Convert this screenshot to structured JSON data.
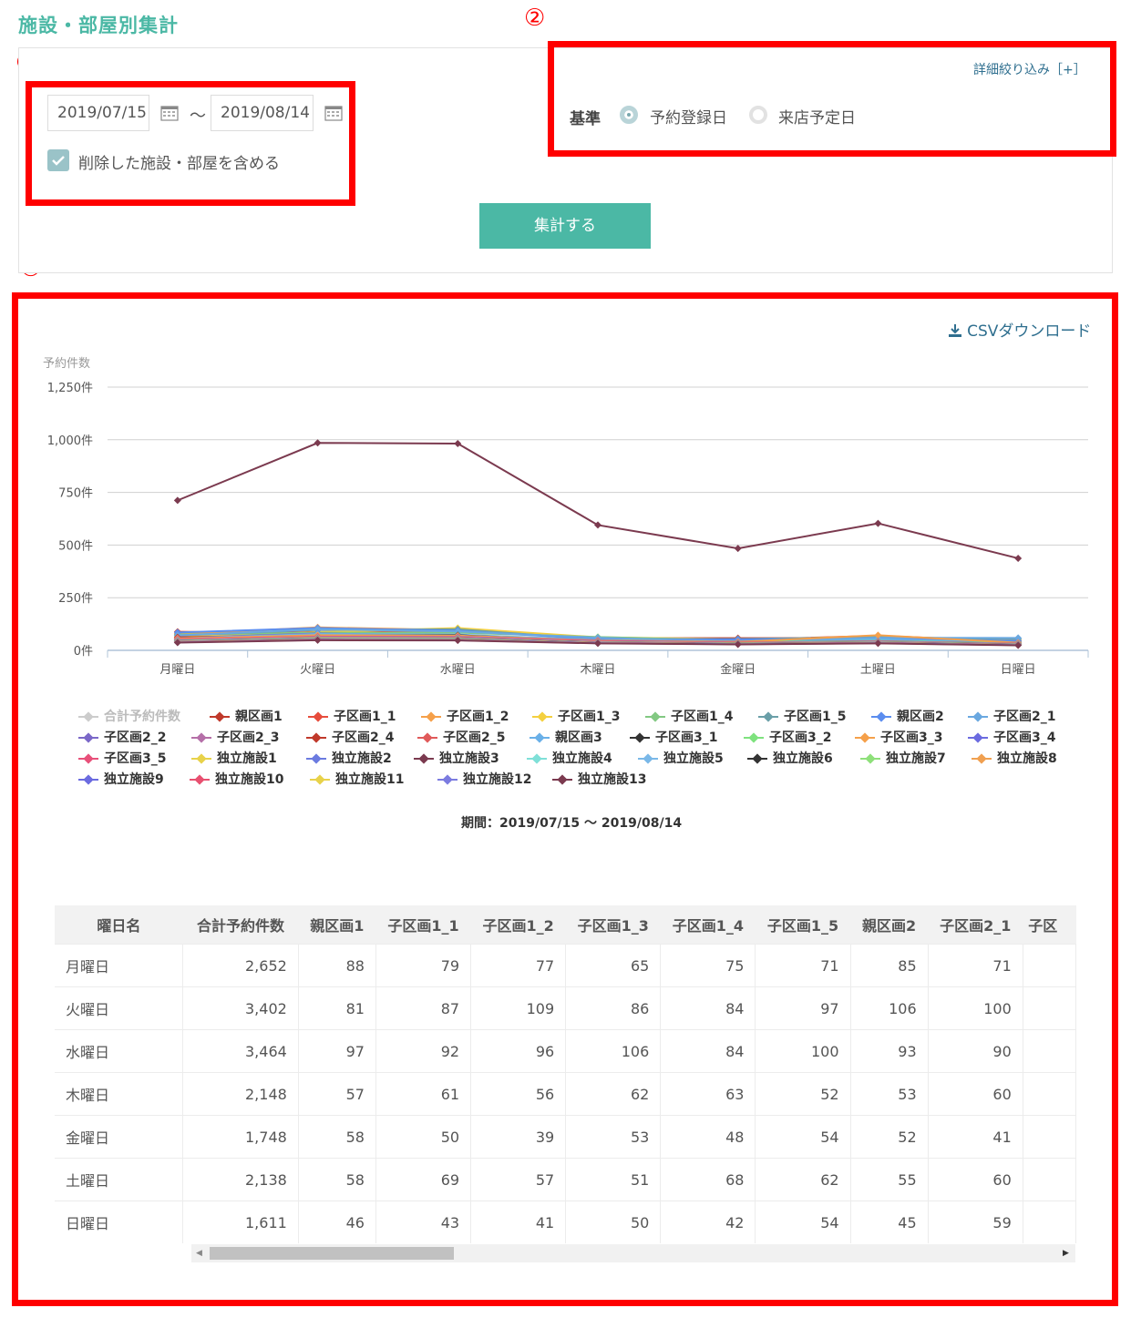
{
  "page": {
    "title": "施設・部屋別集計"
  },
  "markers": [
    "①",
    "②",
    "③"
  ],
  "filters": {
    "date_from": "2019/07/15",
    "tilde": "〜",
    "date_to": "2019/08/14",
    "include_deleted_label": "削除した施設・部屋を含める",
    "include_deleted_checked": true,
    "detail_link": "詳細絞り込み［+］",
    "basis_label": "基準",
    "basis_options": [
      {
        "label": "予約登録日",
        "selected": true
      },
      {
        "label": "来店予定日",
        "selected": false
      }
    ],
    "submit_label": "集計する"
  },
  "csv_label": "CSVダウンロード",
  "chart_data": {
    "type": "line",
    "ylabel": "予約件数",
    "yticks": [
      "1,250件",
      "1,000件",
      "750件",
      "500件",
      "250件",
      "0件"
    ],
    "ylim": [
      0,
      1250
    ],
    "categories": [
      "月曜日",
      "火曜日",
      "水曜日",
      "木曜日",
      "金曜日",
      "土曜日",
      "日曜日"
    ],
    "legend_position": "bottom",
    "grid": true,
    "series": [
      {
        "name": "合計予約件数",
        "color": "#cccccc",
        "hidden": true,
        "values": [
          2652,
          3402,
          3464,
          2148,
          1748,
          2138,
          1611
        ]
      },
      {
        "name": "親区画1",
        "color": "#c0392b",
        "values": [
          88,
          81,
          97,
          57,
          58,
          58,
          46
        ]
      },
      {
        "name": "子区画1_1",
        "color": "#e74c3c",
        "values": [
          79,
          87,
          92,
          61,
          50,
          69,
          43
        ]
      },
      {
        "name": "子区画1_2",
        "color": "#f5a04a",
        "values": [
          77,
          109,
          96,
          56,
          39,
          57,
          41
        ]
      },
      {
        "name": "子区画1_3",
        "color": "#f4d03f",
        "values": [
          65,
          86,
          106,
          62,
          53,
          51,
          50
        ]
      },
      {
        "name": "子区画1_4",
        "color": "#82c882",
        "values": [
          75,
          84,
          84,
          63,
          48,
          68,
          42
        ]
      },
      {
        "name": "子区画1_5",
        "color": "#6a9fa8",
        "values": [
          71,
          97,
          100,
          52,
          54,
          62,
          54
        ]
      },
      {
        "name": "親区画2",
        "color": "#5b8def",
        "values": [
          85,
          106,
          93,
          53,
          52,
          55,
          45
        ]
      },
      {
        "name": "子区画2_1",
        "color": "#6aa8e0",
        "values": [
          71,
          100,
          90,
          60,
          41,
          60,
          59
        ]
      },
      {
        "name": "子区画2_2",
        "color": "#7b68c8",
        "values": [
          60,
          80,
          70,
          50,
          40,
          48,
          38
        ]
      },
      {
        "name": "子区画2_3",
        "color": "#b56fa8",
        "values": [
          58,
          75,
          72,
          45,
          42,
          50,
          36
        ]
      },
      {
        "name": "子区画2_4",
        "color": "#c0392b",
        "values": [
          62,
          70,
          68,
          48,
          40,
          46,
          35
        ]
      },
      {
        "name": "子区画2_5",
        "color": "#e05a5a",
        "values": [
          55,
          66,
          60,
          44,
          38,
          44,
          33
        ]
      },
      {
        "name": "親区画3",
        "color": "#6ab0e8",
        "values": [
          57,
          78,
          75,
          49,
          41,
          52,
          37
        ]
      },
      {
        "name": "子区画3_1",
        "color": "#333333",
        "values": [
          50,
          70,
          72,
          42,
          36,
          40,
          30
        ]
      },
      {
        "name": "子区画3_2",
        "color": "#7ee27e",
        "values": [
          54,
          68,
          66,
          46,
          39,
          45,
          34
        ]
      },
      {
        "name": "子区画3_3",
        "color": "#f5a04a",
        "values": [
          56,
          72,
          70,
          47,
          40,
          72,
          36
        ]
      },
      {
        "name": "子区画3_4",
        "color": "#6b6be0",
        "values": [
          52,
          65,
          64,
          45,
          37,
          43,
          32
        ]
      },
      {
        "name": "子区画3_5",
        "color": "#e8507a",
        "values": [
          53,
          64,
          62,
          44,
          36,
          42,
          31
        ]
      },
      {
        "name": "独立施設1",
        "color": "#e8d24a",
        "values": [
          48,
          60,
          58,
          40,
          34,
          40,
          30
        ]
      },
      {
        "name": "独立施設2",
        "color": "#6b7be0",
        "values": [
          47,
          58,
          57,
          39,
          33,
          39,
          29
        ]
      },
      {
        "name": "独立施設3",
        "color": "#7b3a4f",
        "values": [
          712,
          985,
          982,
          595,
          484,
          603,
          437
        ]
      },
      {
        "name": "独立施設4",
        "color": "#7fe0d8",
        "values": [
          46,
          57,
          56,
          38,
          33,
          38,
          29
        ]
      },
      {
        "name": "独立施設5",
        "color": "#7ab8e8",
        "values": [
          45,
          56,
          55,
          38,
          32,
          38,
          28
        ]
      },
      {
        "name": "独立施設6",
        "color": "#333333",
        "values": [
          44,
          55,
          54,
          37,
          32,
          37,
          28
        ]
      },
      {
        "name": "独立施設7",
        "color": "#8ee07a",
        "values": [
          43,
          54,
          53,
          36,
          31,
          36,
          27
        ]
      },
      {
        "name": "独立施設8",
        "color": "#f0a050",
        "values": [
          42,
          53,
          52,
          36,
          31,
          36,
          27
        ]
      },
      {
        "name": "独立施設9",
        "color": "#6b6be0",
        "values": [
          41,
          52,
          51,
          35,
          30,
          35,
          26
        ]
      },
      {
        "name": "独立施設10",
        "color": "#e85070",
        "values": [
          40,
          51,
          50,
          35,
          30,
          35,
          26
        ]
      },
      {
        "name": "独立施設11",
        "color": "#e8d24a",
        "values": [
          39,
          50,
          49,
          34,
          29,
          34,
          25
        ]
      },
      {
        "name": "独立施設12",
        "color": "#7b7be0",
        "values": [
          38,
          49,
          48,
          34,
          29,
          34,
          25
        ]
      },
      {
        "name": "独立施設13",
        "color": "#7b3a4f",
        "values": [
          37,
          48,
          47,
          33,
          28,
          33,
          24
        ]
      }
    ]
  },
  "period_text": "期間：2019/07/15 〜 2019/08/14",
  "table": {
    "headers": [
      "曜日名",
      "合計予約件数",
      "親区画1",
      "子区画1_1",
      "子区画1_2",
      "子区画1_3",
      "子区画1_4",
      "子区画1_5",
      "親区画2",
      "子区画2_1",
      "子区"
    ],
    "rows": [
      [
        "月曜日",
        "2,652",
        "88",
        "79",
        "77",
        "65",
        "75",
        "71",
        "85",
        "71",
        ""
      ],
      [
        "火曜日",
        "3,402",
        "81",
        "87",
        "109",
        "86",
        "84",
        "97",
        "106",
        "100",
        ""
      ],
      [
        "水曜日",
        "3,464",
        "97",
        "92",
        "96",
        "106",
        "84",
        "100",
        "93",
        "90",
        ""
      ],
      [
        "木曜日",
        "2,148",
        "57",
        "61",
        "56",
        "62",
        "63",
        "52",
        "53",
        "60",
        ""
      ],
      [
        "金曜日",
        "1,748",
        "58",
        "50",
        "39",
        "53",
        "48",
        "54",
        "52",
        "41",
        ""
      ],
      [
        "土曜日",
        "2,138",
        "58",
        "69",
        "57",
        "51",
        "68",
        "62",
        "55",
        "60",
        ""
      ],
      [
        "日曜日",
        "1,611",
        "46",
        "43",
        "41",
        "50",
        "42",
        "54",
        "45",
        "59",
        ""
      ]
    ]
  }
}
